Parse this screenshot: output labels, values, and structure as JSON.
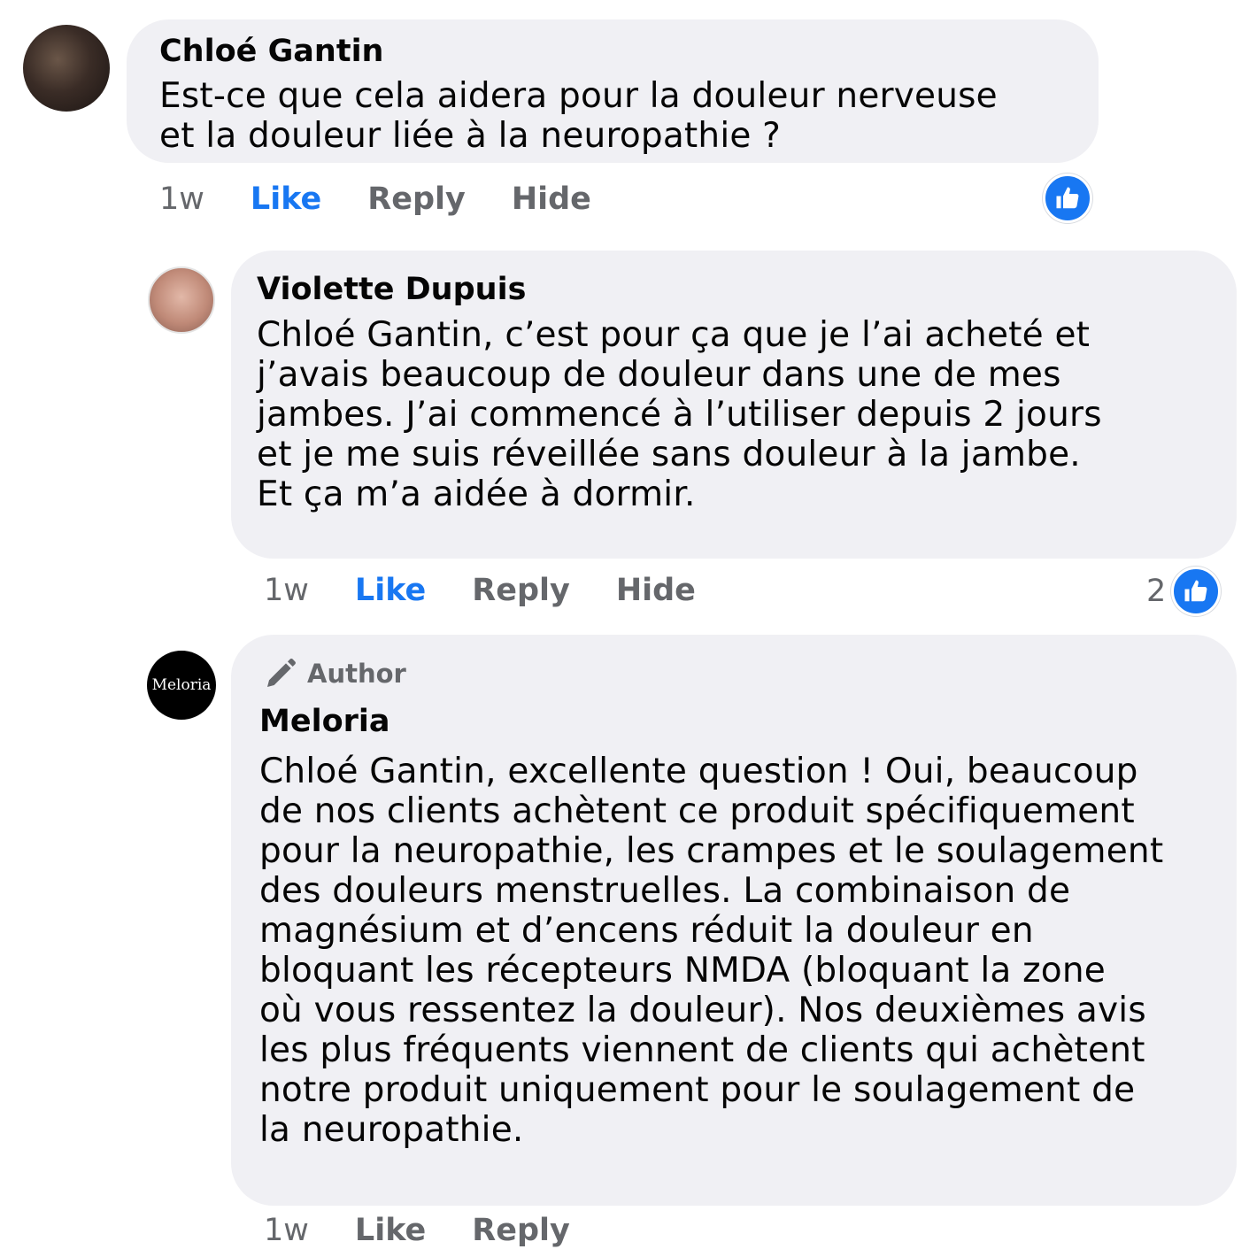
{
  "comments": [
    {
      "author": "Chloé Gantin",
      "text": "Est-ce que cela aidera pour la douleur nerveuse\net la douleur liée à la neuropathie ?",
      "time": "1w",
      "actions": {
        "like": "Like",
        "reply": "Reply",
        "hide": "Hide"
      },
      "reaction_count": ""
    },
    {
      "author": "Violette Dupuis",
      "text": "Chloé Gantin, c’est pour ça que je l’ai acheté et\nj’avais beaucoup de douleur dans une de mes\njambes. J’ai commencé à l’utiliser depuis 2 jours\net je me suis réveillée sans douleur à la jambe.\nEt ça m’a aidée à dormir.",
      "time": "1w",
      "actions": {
        "like": "Like",
        "reply": "Reply",
        "hide": "Hide"
      },
      "reaction_count": "2"
    },
    {
      "badge": "Author",
      "author": "Meloria",
      "avatar_text": "Meloria",
      "text": "Chloé Gantin, excellente question ! Oui, beaucoup\nde nos clients achètent ce produit spécifiquement\npour la neuropathie, les crampes et le soulagement\ndes douleurs menstruelles. La combinaison de\nmagnésium et d’encens réduit la douleur en\nbloquant les récepteurs NMDA (bloquant la zone\noù vous ressentez la douleur). Nos deuxièmes avis\nles plus fréquents viennent de clients qui achètent\nnotre produit uniquement pour le soulagement de\nla neuropathie.",
      "time": "1w",
      "actions": {
        "like": "Like",
        "reply": "Reply"
      }
    }
  ],
  "colors": {
    "bubble": "#f0f0f4",
    "like_active": "#1877f2",
    "muted": "#65676b",
    "text": "#050505"
  },
  "icons": [
    "thumbs-up-icon",
    "pencil-icon"
  ]
}
